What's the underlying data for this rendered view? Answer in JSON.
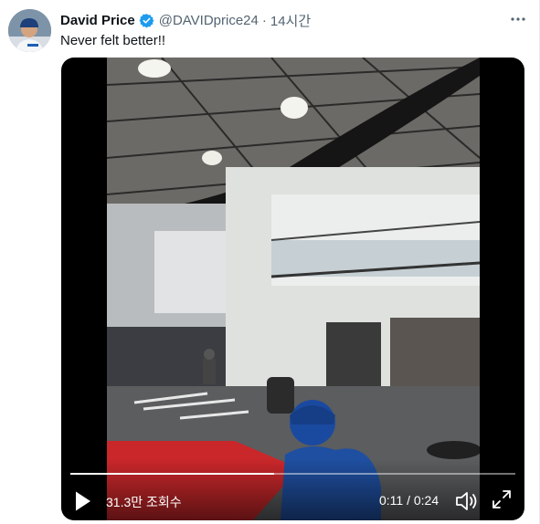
{
  "tweet": {
    "author_name": "David Price",
    "handle": "@DAVIDprice24",
    "separator": "·",
    "time": "14시간",
    "text": "Never felt better!!",
    "verified": true
  },
  "video": {
    "views": "31.3만 조회수",
    "elapsed": "0:11",
    "duration": "0:24",
    "time_display": "0:11 / 0:24",
    "progress": 0.458,
    "icons": {
      "play": "play-icon",
      "volume": "volume-icon",
      "fullscreen": "fullscreen-icon"
    }
  },
  "colors": {
    "verified": "#1d9bf0",
    "name": "#0f1419",
    "secondary": "#536471"
  }
}
